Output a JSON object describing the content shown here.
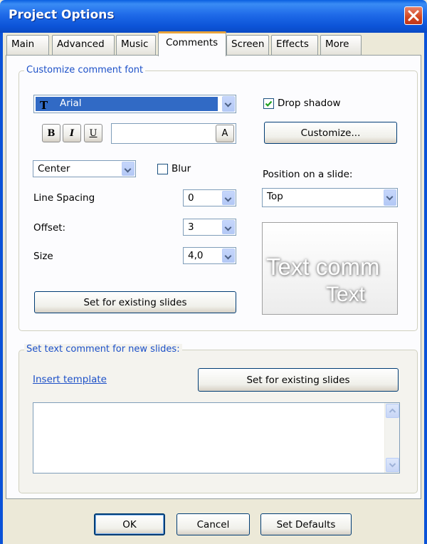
{
  "window": {
    "title": "Project Options"
  },
  "tabs": [
    {
      "label": "Main",
      "active": false
    },
    {
      "label": "Advanced",
      "active": false
    },
    {
      "label": "Music",
      "active": false
    },
    {
      "label": "Comments",
      "active": true
    },
    {
      "label": "Screen",
      "active": false
    },
    {
      "label": "Effects",
      "active": false
    },
    {
      "label": "More",
      "active": false
    }
  ],
  "font_group": {
    "legend": "Customize comment font",
    "font_select": {
      "value": "Arial",
      "icon": "truetype-font-icon"
    },
    "bold_label": "B",
    "italic_label": "I",
    "underline_label": "U",
    "color_value": "",
    "color_button_label": "A",
    "alignment_select": {
      "value": "Center"
    },
    "blur": {
      "label": "Blur",
      "checked": false
    },
    "line_spacing": {
      "label": "Line Spacing",
      "value": "0"
    },
    "offset": {
      "label": "Offset:",
      "value": "3"
    },
    "size": {
      "label": "Size",
      "value": "4,0"
    },
    "set_existing_label": "Set for existing slides",
    "drop_shadow": {
      "label": "Drop shadow",
      "checked": true
    },
    "customize_label": "Customize...",
    "position_label": "Position on a slide:",
    "position_select": {
      "value": "Top"
    },
    "preview": {
      "line1": "Text comm",
      "line2": "Text"
    }
  },
  "text_group": {
    "legend": "Set text comment for new slides:",
    "insert_template_label": "Insert template",
    "set_existing_label": "Set for existing slides",
    "comment_text": ""
  },
  "footer": {
    "ok_label": "OK",
    "cancel_label": "Cancel",
    "defaults_label": "Set Defaults"
  },
  "colors": {
    "titlebar": "#0a5fe0",
    "legend_text": "#1c50c8",
    "link_text": "#1c50c8",
    "font_select_highlight": "#316ac5"
  }
}
